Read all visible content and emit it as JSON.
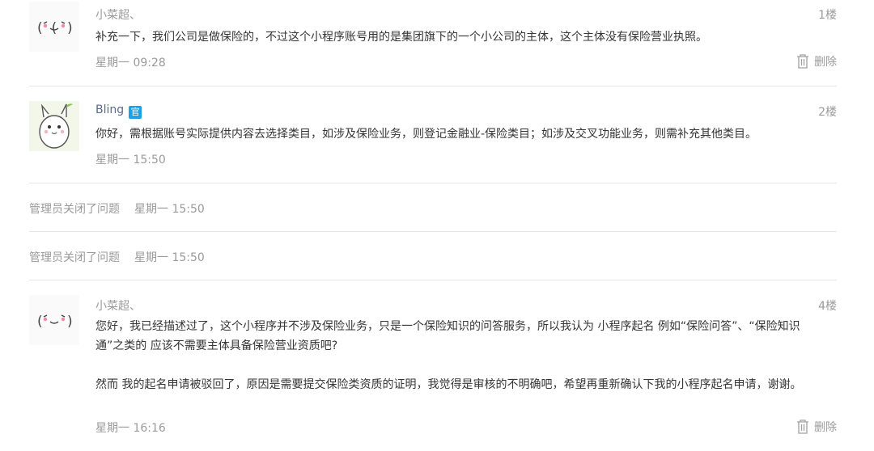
{
  "posts": [
    {
      "author": "小菜超、",
      "floor": "1楼",
      "content": [
        "补充一下，我们公司是做保险的，不过这个小程序账号用的是集团旗下的一个小公司的主体，这个主体没有保险营业执照。"
      ],
      "time": "星期一 09:28",
      "delete_label": "删除",
      "avatar_icon": "kaomoji-face-icon"
    },
    {
      "author": "Bling",
      "badge": "官",
      "floor": "2楼",
      "content": [
        "你好，需根据账号实际提供内容去选择类目，如涉及保险业务，则登记金融业-保险类目；如涉及交叉功能业务，则需补充其他类目。"
      ],
      "time": "星期一 15:50",
      "avatar_icon": "bunny-mascot-icon"
    },
    {
      "author": "小菜超、",
      "floor": "4楼",
      "content": [
        "您好，我已经描述过了，这个小程序并不涉及保险业务，只是一个保险知识的问答服务，所以我认为 小程序起名 例如“保险问答”、“保险知识通”之类的 应该不需要主体具备保险营业资质吧?",
        "然而 我的起名申请被驳回了，原因是需要提交保险类资质的证明，我觉得是审核的不明确吧，希望再重新确认下我的小程序起名申请，谢谢。"
      ],
      "time": "星期一 16:16",
      "delete_label": "删除",
      "avatar_icon": "kaomoji-face-icon"
    }
  ],
  "system_events": [
    {
      "text": "管理员关闭了问题",
      "time": "星期一 15:50"
    },
    {
      "text": "管理员关闭了问题",
      "time": "星期一 15:50"
    }
  ],
  "colors": {
    "badge": "#1aa1e8",
    "muted": "#9a9a9a",
    "text": "#353535",
    "divider": "#e7e7e7"
  }
}
